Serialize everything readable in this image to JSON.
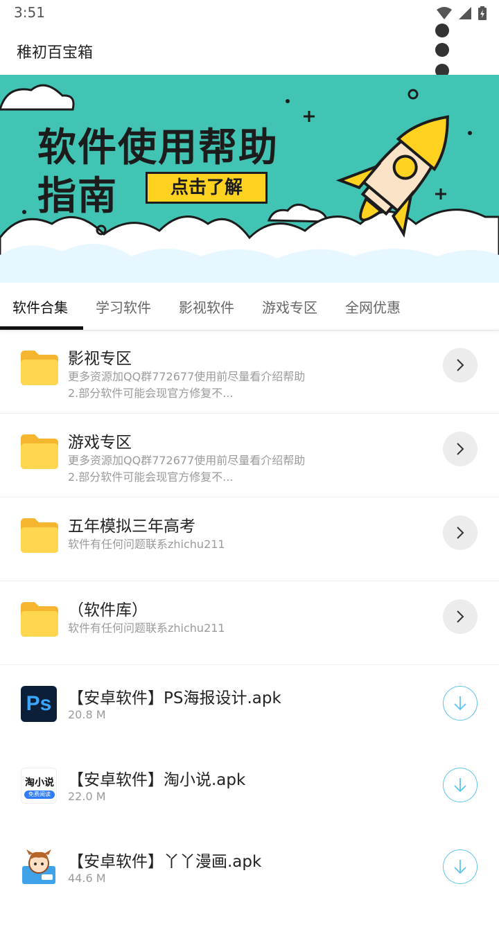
{
  "status_bar": {
    "time": "3:51"
  },
  "app_bar": {
    "title": "稚初百宝箱"
  },
  "banner": {
    "title_line1": "软件使用帮助",
    "title_line2": "指南",
    "button_label": "点击了解",
    "background_color": "#41c4b3",
    "accent_color": "#ffd21f"
  },
  "tabs": [
    {
      "label": "软件合集",
      "active": true
    },
    {
      "label": "学习软件"
    },
    {
      "label": "影视软件"
    },
    {
      "label": "游戏专区"
    },
    {
      "label": "全网优惠"
    }
  ],
  "folders": [
    {
      "name": "影视专区",
      "desc_line1": "更多资源加QQ群772677使用前尽量看介绍帮助",
      "desc_line2": "2.部分软件可能会现官方修复不..."
    },
    {
      "name": "游戏专区",
      "desc_line1": "更多资源加QQ群772677使用前尽量看介绍帮助",
      "desc_line2": "2.部分软件可能会现官方修复不..."
    },
    {
      "name": "五年模拟三年高考",
      "desc_line1": "软件有任何问题联系zhichu211",
      "desc_line2": ""
    },
    {
      "name": "（软件库）",
      "desc_line1": "软件有任何问题联系zhichu211",
      "desc_line2": ""
    }
  ],
  "files": [
    {
      "name": "【安卓软件】PS海报设计.apk",
      "size": "20.8 M",
      "icon": "photoshop-icon",
      "icon_text": "Ps"
    },
    {
      "name": "【安卓软件】淘小说.apk",
      "size": "22.0 M",
      "icon": "taoxiaoshuo-icon",
      "icon_text": "淘小说",
      "icon_sub": "免费阅读"
    },
    {
      "name": "【安卓软件】丫丫漫画.apk",
      "size": "44.6 M",
      "icon": "yaya-manhua-icon"
    }
  ]
}
